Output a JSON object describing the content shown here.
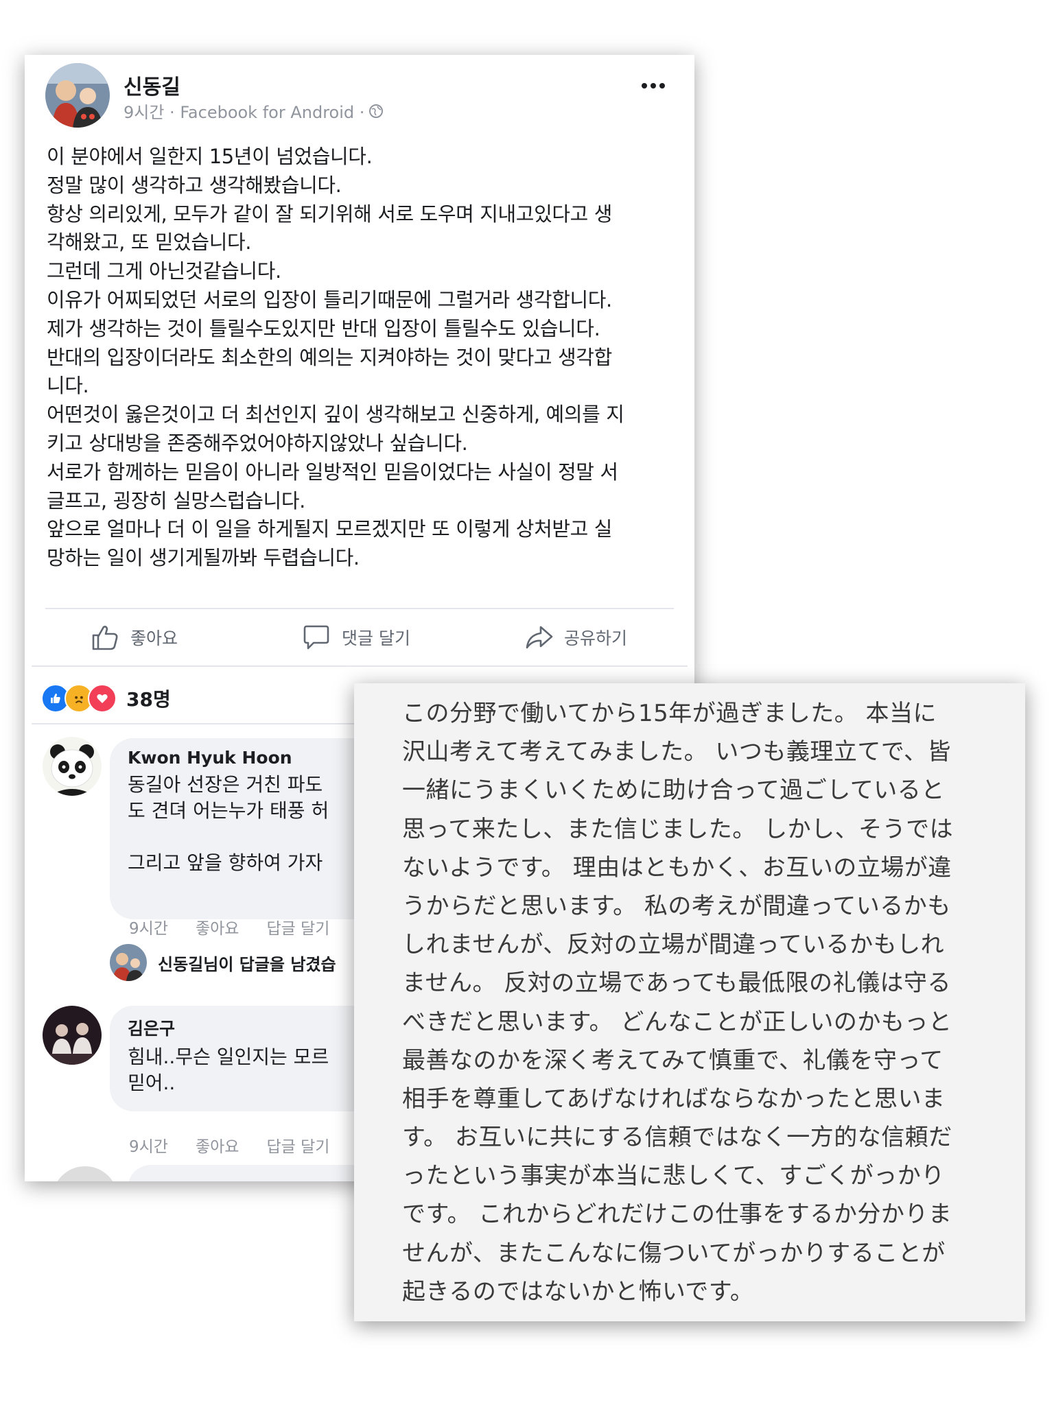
{
  "post": {
    "author": "신동길",
    "meta": "9시간 · Facebook for Android ·",
    "lines": [
      "이 분야에서 일한지 15년이 넘었습니다.",
      "정말 많이 생각하고 생각해봤습니다.",
      "항상 의리있게, 모두가 같이 잘 되기위해 서로 도우며 지내고있다고 생",
      "각해왔고, 또 믿었습니다.",
      "그런데 그게 아닌것같습니다.",
      "이유가 어찌되었던 서로의 입장이 틀리기때문에 그럴거라 생각합니다.",
      "제가 생각하는 것이 틀릴수도있지만 반대 입장이 틀릴수도 있습니다.",
      "반대의 입장이더라도 최소한의 예의는 지켜야하는 것이 맞다고 생각합",
      "니다.",
      "어떤것이 옳은것이고 더 최선인지 깊이 생각해보고 신중하게, 예의를 지",
      "키고 상대방을 존중해주었어야하지않았나 싶습니다.",
      "서로가 함께하는 믿음이 아니라 일방적인 믿음이었다는 사실이 정말 서",
      "글프고, 굉장히 실망스럽습니다.",
      "앞으로 얼마나 더 이 일을 하게될지 모르겠지만 또 이렇게 상처받고 실",
      "망하는 일이 생기게될까봐 두렵습니다."
    ]
  },
  "actions": {
    "like": "좋아요",
    "comment": "댓글 달기",
    "share": "공유하기"
  },
  "reactions": {
    "count": "38명"
  },
  "comments": [
    {
      "name": "Kwon Hyuk Hoon",
      "lines": [
        "동길아 선장은 거친 파도",
        "도 견뎌 어는누가 태풍 허",
        "",
        "그리고 앞을 향하여 가자"
      ],
      "time": "9시간",
      "like": "좋아요",
      "reply": "답글 달기"
    },
    {
      "name": "김은구",
      "lines": [
        "힘내..무슨 일인지는 모르",
        "믿어.."
      ],
      "time": "9시간",
      "like": "좋아요",
      "reply": "답글 달기"
    }
  ],
  "reply_notice": "신동길님이 답글을 남겼습",
  "translation": {
    "lines": [
      "この分野で働いてから15年が過ぎました。 本当に",
      "沢山考えて考えてみました。 いつも義理立てで、皆",
      "一緒にうまくいくために助け合って過ごしていると",
      "思って来たし、また信じました。 しかし、そうでは",
      "ないようです。 理由はともかく、お互いの立場が違",
      "うからだと思います。 私の考えが間違っているかも",
      "しれませんが、反対の立場が間違っているかもしれ",
      "ません。 反対の立場であっても最低限の礼儀は守る",
      "べきだと思います。 どんなことが正しいのかもっと",
      "最善なのかを深く考えてみて慎重で、礼儀を守って",
      "相手を尊重してあげなければならなかったと思いま",
      "す。 お互いに共にする信頼ではなく一方的な信頼だ",
      "ったという事実が本当に悲しくて、すごくがっかり",
      "です。 これからどれだけこの仕事をするか分かりま",
      "せんが、またこんなに傷ついてがっかりすることが",
      "起きるのではないかと怖いです。"
    ]
  },
  "colors": {
    "like_blue": "#1877f2",
    "love_red": "#f33e58",
    "sad_yellow": "#f7b125",
    "meta_gray": "#90949c"
  }
}
